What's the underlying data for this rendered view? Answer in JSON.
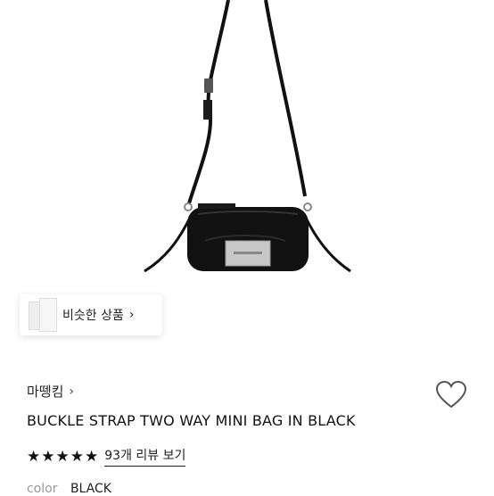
{
  "similar": {
    "label": "비슷한 상품"
  },
  "brand": {
    "name": "마뗑킴"
  },
  "product": {
    "title": "BUCKLE STRAP TWO WAY MINI BAG IN BLACK",
    "rating": 5,
    "reviews_label": "93개 리뷰 보기",
    "color_label": "color",
    "color_value": "BLACK"
  },
  "colors": {
    "bag": "#111111",
    "plate": "#c8c8c8",
    "text": "#111111"
  },
  "icons": {
    "wishlist": "heart-outline-icon",
    "chevron": "chevron-right-icon",
    "star": "star-filled-icon"
  }
}
